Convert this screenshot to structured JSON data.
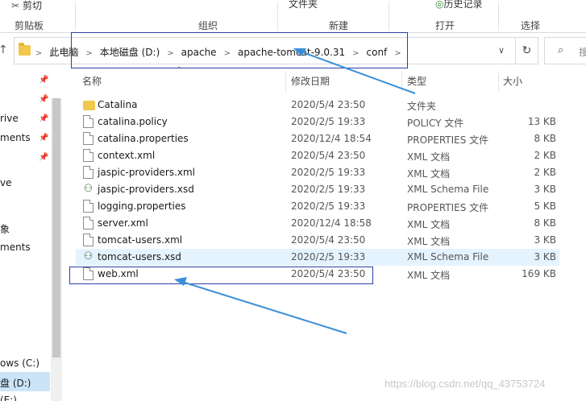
{
  "ribbon": {
    "cut_label": "剪切",
    "top_items": [
      "文件夹",
      "历史记录"
    ],
    "groups": [
      "剪贴板",
      "组织",
      "新建",
      "打开",
      "选择"
    ]
  },
  "address": {
    "crumbs": [
      "此电脑",
      "本地磁盘 (D:)",
      "apache",
      "apache-tomcat-9.0.31",
      "conf"
    ],
    "search_placeholder": "搜"
  },
  "columns": {
    "name": "名称",
    "date": "修改日期",
    "type": "类型",
    "size": "大小"
  },
  "nav_pane": {
    "items": [
      "rive",
      "ments",
      "ve",
      "象",
      "ments",
      "ows (C:)",
      "盘 (D:)",
      "(E:)"
    ]
  },
  "files": [
    {
      "name": "Catalina",
      "date": "2020/5/4 23:50",
      "type": "文件夹",
      "size": "",
      "icon": "folder-icon"
    },
    {
      "name": "catalina.policy",
      "date": "2020/2/5 19:33",
      "type": "POLICY 文件",
      "size": "13 KB",
      "icon": "file-icon"
    },
    {
      "name": "catalina.properties",
      "date": "2020/12/4 18:54",
      "type": "PROPERTIES 文件",
      "size": "8 KB",
      "icon": "file-icon"
    },
    {
      "name": "context.xml",
      "date": "2020/5/4 23:50",
      "type": "XML 文档",
      "size": "2 KB",
      "icon": "file-icon"
    },
    {
      "name": "jaspic-providers.xml",
      "date": "2020/2/5 19:33",
      "type": "XML 文档",
      "size": "2 KB",
      "icon": "file-icon"
    },
    {
      "name": "jaspic-providers.xsd",
      "date": "2020/2/5 19:33",
      "type": "XML Schema File",
      "size": "3 KB",
      "icon": "xsd-icon"
    },
    {
      "name": "logging.properties",
      "date": "2020/2/5 19:33",
      "type": "PROPERTIES 文件",
      "size": "5 KB",
      "icon": "file-icon"
    },
    {
      "name": "server.xml",
      "date": "2020/12/4 18:58",
      "type": "XML 文档",
      "size": "8 KB",
      "icon": "file-icon"
    },
    {
      "name": "tomcat-users.xml",
      "date": "2020/5/4 23:50",
      "type": "XML 文档",
      "size": "3 KB",
      "icon": "file-icon"
    },
    {
      "name": "tomcat-users.xsd",
      "date": "2020/2/5 19:33",
      "type": "XML Schema File",
      "size": "3 KB",
      "icon": "xsd-icon"
    },
    {
      "name": "web.xml",
      "date": "2020/5/4 23:50",
      "type": "XML 文档",
      "size": "169 KB",
      "icon": "file-icon"
    }
  ],
  "watermark": "https://blog.csdn.net/qq_43753724",
  "colors": {
    "highlight_box": "#2b3ea8",
    "arrow": "#3a8ed8",
    "selection": "#cce4f7",
    "hover_row": "#e5f3ff"
  }
}
